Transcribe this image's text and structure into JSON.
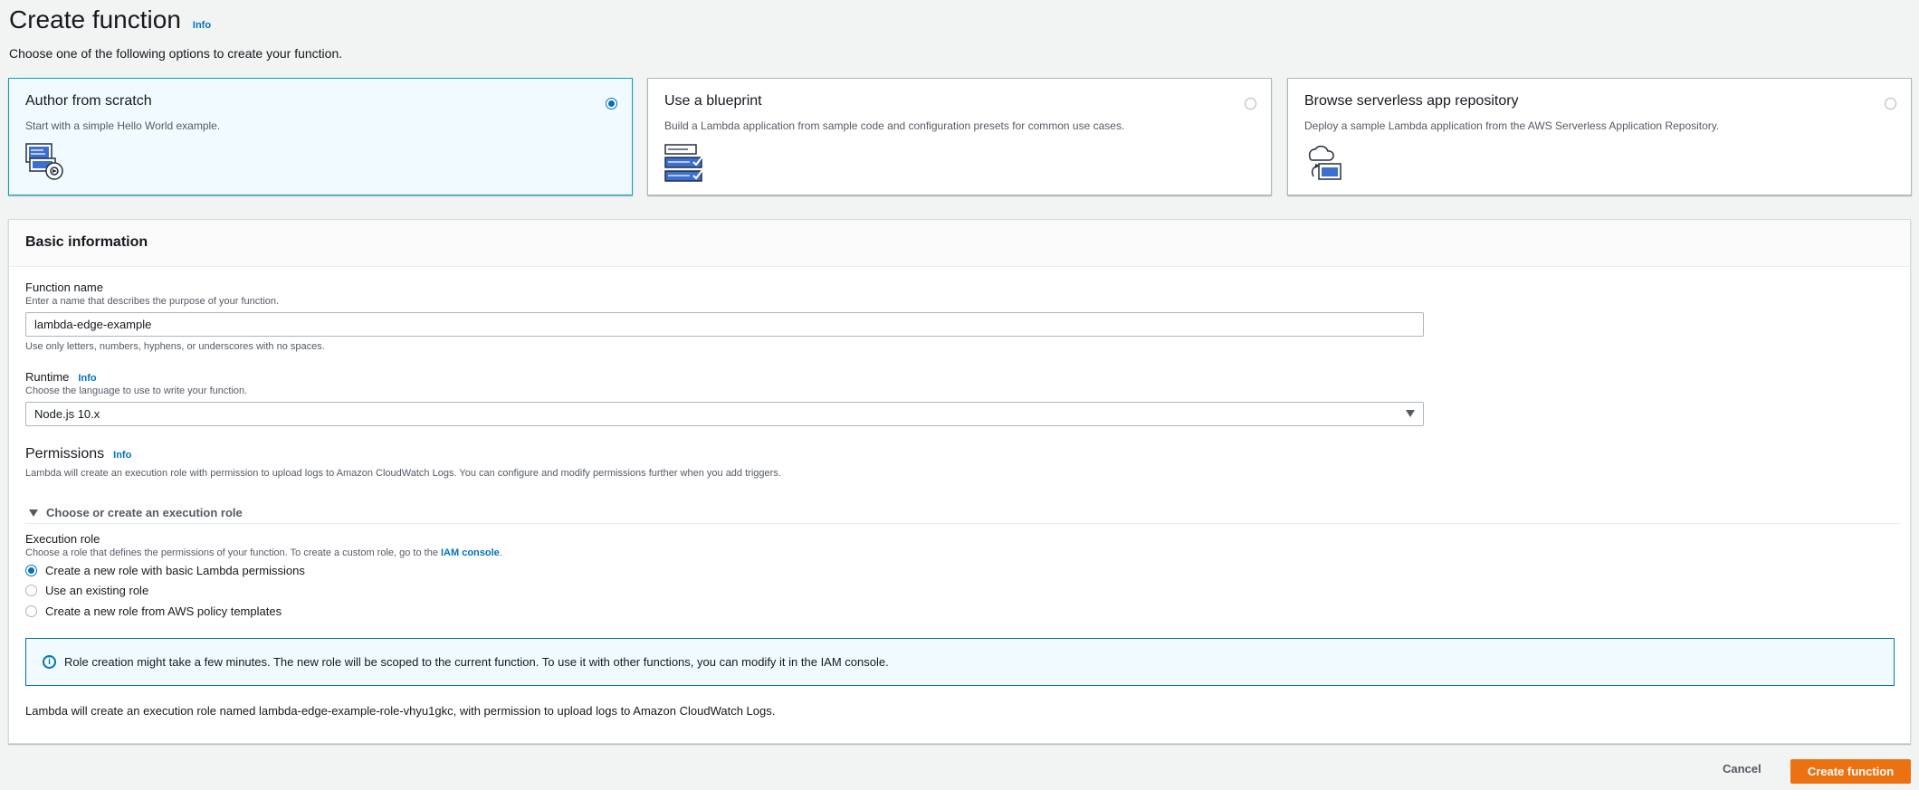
{
  "header": {
    "title": "Create function",
    "info": "Info",
    "subtitle": "Choose one of the following options to create your function."
  },
  "options": [
    {
      "title": "Author from scratch",
      "description": "Start with a simple Hello World example.",
      "selected": true,
      "icon": "author-scratch-icon"
    },
    {
      "title": "Use a blueprint",
      "description": "Build a Lambda application from sample code and configuration presets for common use cases.",
      "selected": false,
      "icon": "blueprint-icon"
    },
    {
      "title": "Browse serverless app repository",
      "description": "Deploy a sample Lambda application from the AWS Serverless Application Repository.",
      "selected": false,
      "icon": "serverless-repo-icon"
    }
  ],
  "basic_info": {
    "title": "Basic information",
    "function_name": {
      "label": "Function name",
      "description": "Enter a name that describes the purpose of your function.",
      "value": "lambda-edge-example",
      "constraint": "Use only letters, numbers, hyphens, or underscores with no spaces."
    },
    "runtime": {
      "label": "Runtime",
      "info": "Info",
      "description": "Choose the language to use to write your function.",
      "value": "Node.js 10.x"
    },
    "permissions": {
      "title": "Permissions",
      "info": "Info",
      "description": "Lambda will create an execution role with permission to upload logs to Amazon CloudWatch Logs. You can configure and modify permissions further when you add triggers.",
      "expander": "Choose or create an execution role",
      "execution_role_label": "Execution role",
      "execution_role_desc_prefix": "Choose a role that defines the permissions of your function. To create a custom role, go to the ",
      "iam_link": "IAM console",
      "execution_role_desc_suffix": ".",
      "radio_options": [
        {
          "label": "Create a new role with basic Lambda permissions",
          "checked": true
        },
        {
          "label": "Use an existing role",
          "checked": false
        },
        {
          "label": "Create a new role from AWS policy templates",
          "checked": false
        }
      ],
      "alert": "Role creation might take a few minutes. The new role will be scoped to the current function. To use it with other functions, you can modify it in the IAM console.",
      "role_note": "Lambda will create an execution role named lambda-edge-example-role-vhyu1gkc, with permission to upload logs to Amazon CloudWatch Logs."
    }
  },
  "footer": {
    "cancel": "Cancel",
    "create": "Create function"
  },
  "colors": {
    "accent": "#0073bb",
    "primary_button": "#ec7211",
    "selected_card_bg": "#f1faff"
  }
}
